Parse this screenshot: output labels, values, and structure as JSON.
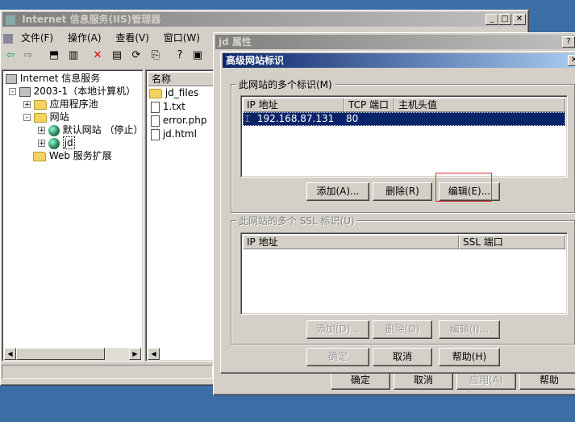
{
  "iis": {
    "title": "Internet 信息服务(IIS)管理器",
    "menu": [
      "文件(F)",
      "操作(A)",
      "查看(V)",
      "窗口(W)",
      "帮"
    ],
    "tree": {
      "root": "Internet 信息服务",
      "computer": "2003-1（本地计算机）",
      "app_pool": "应用程序池",
      "websites": "网站",
      "default_site": "默认网站 （停止）",
      "jd": "jd",
      "web_ext": "Web 服务扩展"
    },
    "list_header": "名称",
    "files": [
      "jd_files",
      "1.txt",
      "error.php",
      "jd.html"
    ]
  },
  "props": {
    "title": "jd 属性",
    "help_q": "?",
    "bottom_buttons": [
      "确定",
      "取消",
      "应用(A)",
      "帮助"
    ]
  },
  "adv": {
    "title": "高级网站标识",
    "group1": {
      "label": "此网站的多个标识(M)",
      "columns": [
        "IP 地址",
        "TCP 端口",
        "主机头值"
      ],
      "rows": [
        {
          "ip": "192.168.87.131",
          "port": "80",
          "host": ""
        }
      ],
      "buttons": [
        "添加(A)...",
        "删除(R)",
        "编辑(E)..."
      ]
    },
    "group2": {
      "label": "此网站的多个 SSL 标识(U)",
      "columns": [
        "IP 地址",
        "SSL 端口"
      ],
      "buttons": [
        "添加(D)...",
        "删除(O)",
        "编辑(I)..."
      ]
    },
    "buttons": {
      "ok": "确定",
      "cancel": "取消",
      "help": "帮助(H)"
    }
  }
}
